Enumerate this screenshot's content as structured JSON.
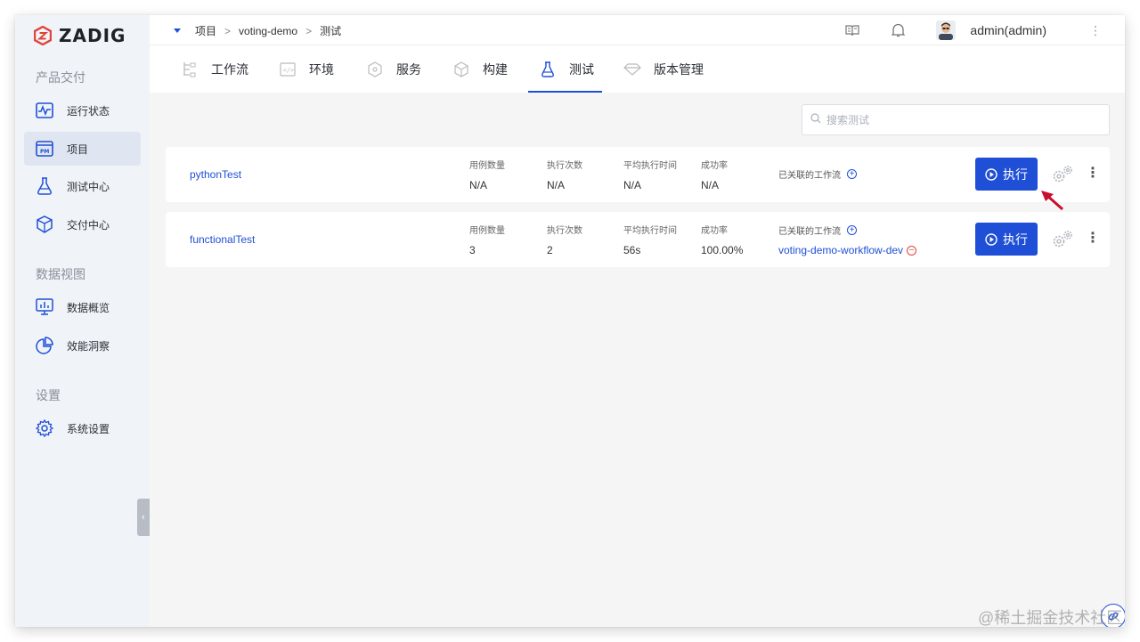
{
  "brand": {
    "name": "ZADIG",
    "accent": "#e0443b"
  },
  "sidebar": {
    "sections": [
      {
        "title": "产品交付"
      },
      {
        "title": "数据视图"
      },
      {
        "title": "设置"
      }
    ],
    "items": [
      {
        "label": "运行状态",
        "icon": "pulse-monitor-icon"
      },
      {
        "label": "项目",
        "icon": "project-pm-icon",
        "active": true
      },
      {
        "label": "测试中心",
        "icon": "flask-icon"
      },
      {
        "label": "交付中心",
        "icon": "cube-package-icon"
      },
      {
        "label": "数据概览",
        "icon": "dashboard-monitor-icon"
      },
      {
        "label": "效能洞察",
        "icon": "pie-chart-icon"
      },
      {
        "label": "系统设置",
        "icon": "gear-icon"
      }
    ]
  },
  "header": {
    "breadcrumb": [
      "项目",
      "voting-demo",
      "测试"
    ],
    "separator": ">",
    "user": "admin(admin)"
  },
  "tabs": [
    {
      "label": "工作流",
      "icon": "workflow-icon"
    },
    {
      "label": "环境",
      "icon": "environment-icon"
    },
    {
      "label": "服务",
      "icon": "service-icon"
    },
    {
      "label": "构建",
      "icon": "build-cube-icon"
    },
    {
      "label": "测试",
      "icon": "flask-icon",
      "active": true
    },
    {
      "label": "版本管理",
      "icon": "diamond-icon"
    }
  ],
  "search": {
    "placeholder": "搜索测试",
    "value": ""
  },
  "metric_labels": {
    "cases": "用例数量",
    "runs": "执行次数",
    "avg_time": "平均执行时间",
    "success": "成功率",
    "workflows": "已关联的工作流"
  },
  "tests": [
    {
      "name": "pythonTest",
      "cases": "N/A",
      "runs": "N/A",
      "avg_time": "N/A",
      "success": "N/A",
      "workflow": ""
    },
    {
      "name": "functionalTest",
      "cases": "3",
      "runs": "2",
      "avg_time": "56s",
      "success": "100.00%",
      "workflow": "voting-demo-workflow-dev"
    }
  ],
  "actions": {
    "run_label": "执行"
  },
  "watermark": "@稀土掘金技术社区",
  "colors": {
    "primary": "#1f4fd6",
    "danger": "#e0443b",
    "annotation": "#c8102e"
  }
}
